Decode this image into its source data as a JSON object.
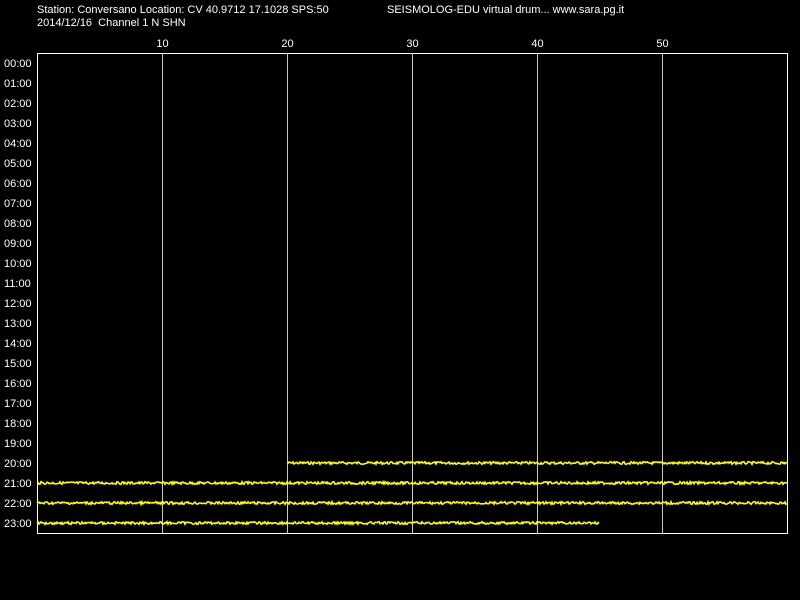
{
  "header": {
    "station_line": "Station: Conversano Location: CV 40.9712 17.1028 SPS:50",
    "app_line": "SEISMOLOG-EDU virtual drum... www.sara.pg.it",
    "date_line": "2014/12/16  Channel 1 N SHN"
  },
  "colors": {
    "background": "#000000",
    "frame": "#ffffff",
    "grid": "#c8c8c8",
    "trace": "#ffff00",
    "text": "#ffffff"
  },
  "chart_data": {
    "type": "line",
    "x_unit": "minutes",
    "xlim": [
      0,
      60
    ],
    "x_ticks": [
      10,
      20,
      30,
      40,
      50
    ],
    "grid": true,
    "hours": [
      "00:00",
      "01:00",
      "02:00",
      "03:00",
      "04:00",
      "05:00",
      "06:00",
      "07:00",
      "08:00",
      "09:00",
      "10:00",
      "11:00",
      "12:00",
      "13:00",
      "14:00",
      "15:00",
      "16:00",
      "17:00",
      "18:00",
      "19:00",
      "20:00",
      "21:00",
      "22:00",
      "23:00"
    ],
    "traces": [
      {
        "hour": "20:00",
        "start_min": 20,
        "end_min": 60
      },
      {
        "hour": "21:00",
        "start_min": 0,
        "end_min": 60
      },
      {
        "hour": "22:00",
        "start_min": 0,
        "end_min": 60
      },
      {
        "hour": "23:00",
        "start_min": 0,
        "end_min": 45
      }
    ]
  }
}
